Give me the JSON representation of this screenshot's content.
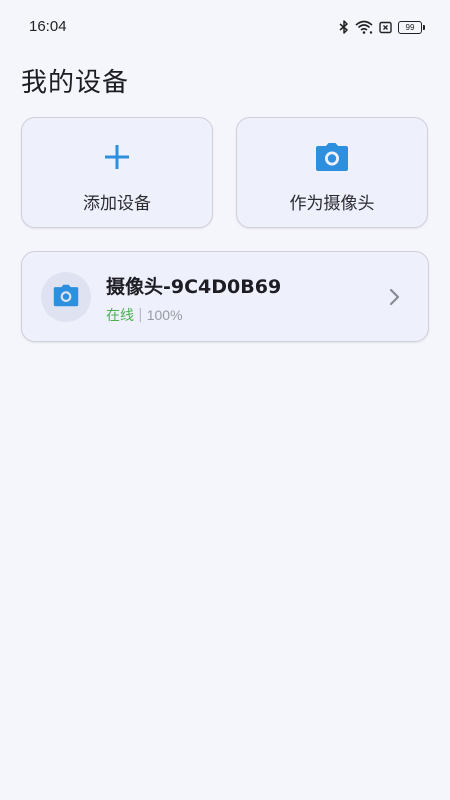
{
  "status_bar": {
    "time": "16:04",
    "battery_level": "99",
    "icons": [
      "bluetooth-icon",
      "wifi-icon",
      "sim-icon",
      "battery-icon"
    ]
  },
  "page": {
    "title": "我的设备"
  },
  "actions": {
    "add_device": {
      "label": "添加设备",
      "icon": "plus-icon"
    },
    "use_as_camera": {
      "label": "作为摄像头",
      "icon": "camera-icon"
    }
  },
  "devices": [
    {
      "name": "摄像头-9C4D0B69",
      "status": "在线",
      "separator": "|",
      "battery": "100%",
      "icon": "camera-icon"
    }
  ],
  "colors": {
    "accent": "#2f8fdf",
    "online": "#4caf50",
    "card_bg": "#eef0fb",
    "page_bg": "#f5f6fb"
  }
}
